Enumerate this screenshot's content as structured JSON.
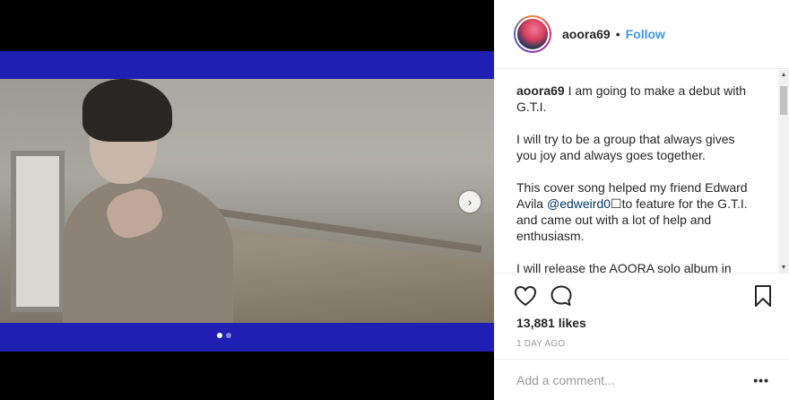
{
  "post": {
    "username": "aoora69",
    "follow_label": "Follow",
    "separator": "•",
    "caption_username": "aoora69",
    "caption_paragraphs": [
      " I am going to make a debut with G.T.I.",
      "I will try to be a group that always gives you joy and always goes together.",
      "This cover song helped my friend Edward Avila ",
      "I will release the AOORA solo album in July,"
    ],
    "mention": "@edweird0",
    "mention_after": "☐to feature for the G.T.I. and came out with a lot of help and enthusiasm.",
    "likes": "13,881 likes",
    "time_ago": "1 DAY AGO",
    "comment_placeholder": "Add a comment...",
    "more_label": "•••"
  },
  "carousel": {
    "next_arrow": "›",
    "current_index": 1,
    "total": 2
  },
  "icons": {
    "like": "heart-icon",
    "comment": "comment-icon",
    "save": "bookmark-icon"
  },
  "colors": {
    "accent": "#3897f0",
    "letterbox_blue": "#1f1fb3",
    "text": "#262626",
    "muted": "#999999"
  }
}
